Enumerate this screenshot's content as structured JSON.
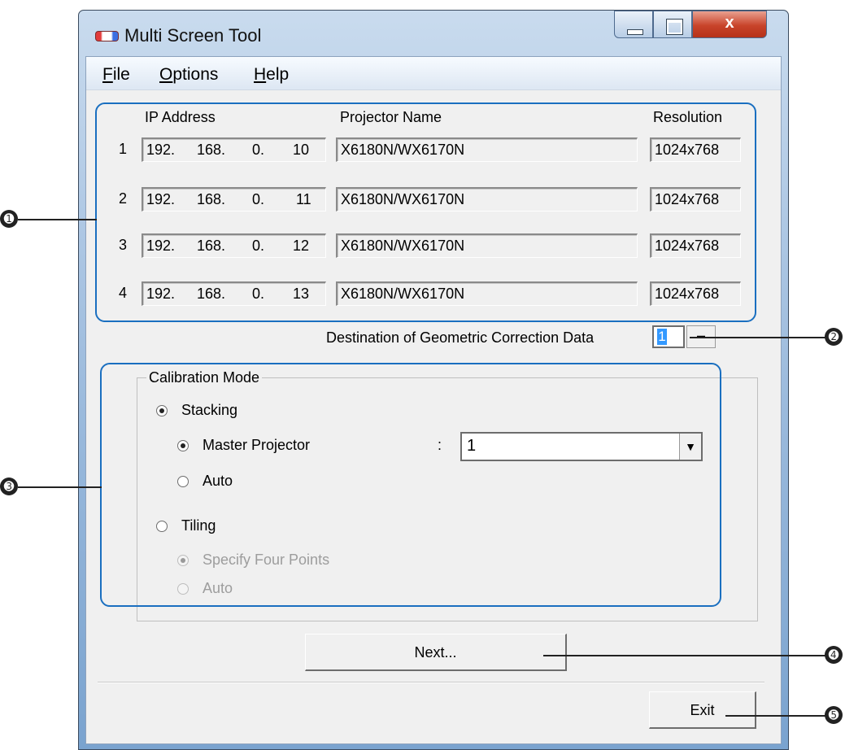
{
  "window": {
    "title": "Multi Screen Tool",
    "close_glyph": "x"
  },
  "menu": [
    {
      "underline": "F",
      "rest": "ile"
    },
    {
      "underline": "O",
      "rest": "ptions"
    },
    {
      "underline": "H",
      "rest": "elp"
    }
  ],
  "table": {
    "headers": {
      "ip": "IP Address",
      "name": "Projector Name",
      "resolution": "Resolution"
    },
    "rows": [
      {
        "index": "1",
        "ip": [
          "192.",
          "168.",
          "0.",
          "10"
        ],
        "name": "X6180N/WX6170N",
        "resolution": "1024x768"
      },
      {
        "index": "2",
        "ip": [
          "192.",
          "168.",
          "0.",
          "11"
        ],
        "name": "X6180N/WX6170N",
        "resolution": "1024x768"
      },
      {
        "index": "3",
        "ip": [
          "192.",
          "168.",
          "0.",
          "12"
        ],
        "name": "X6180N/WX6170N",
        "resolution": "1024x768"
      },
      {
        "index": "4",
        "ip": [
          "192.",
          "168.",
          "0.",
          "13"
        ],
        "name": "X6180N/WX6170N",
        "resolution": "1024x768"
      }
    ]
  },
  "destination": {
    "label": "Destination of Geometric Correction Data",
    "value": "1",
    "spin_glyph": "–"
  },
  "calibration": {
    "group_title": "Calibration Mode",
    "stacking_label": "Stacking",
    "master_label": "Master Projector",
    "colon": ":",
    "master_value": "1",
    "stacking_auto_label": "Auto",
    "tiling_label": "Tiling",
    "four_points_label": "Specify Four Points",
    "tiling_auto_label": "Auto",
    "selected": {
      "mode": "Stacking",
      "stacking_sub": "Master Projector",
      "tiling_sub": "Specify Four Points"
    }
  },
  "buttons": {
    "next": "Next...",
    "exit": "Exit"
  },
  "callouts": [
    "➊",
    "➋",
    "➌",
    "➍",
    "➎"
  ],
  "colors": {
    "highlight": "#1a6fc0",
    "close_button": "#c8432a",
    "selection": "#3399ff"
  }
}
